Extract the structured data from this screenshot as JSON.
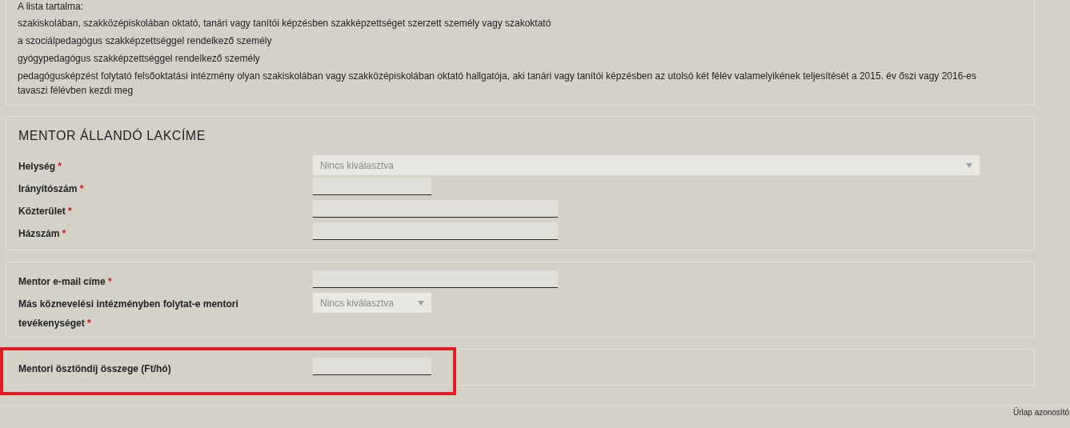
{
  "list_panel": {
    "heading": "A lista tartalma:",
    "items": [
      "szakiskolában, szakközépiskolában oktató, tanári vagy tanítói képzésben szakképzettséget szerzett személy vagy szakoktató",
      "a szociálpedagógus szakképzettséggel rendelkező személy",
      "gyógypedagógus szakképzettséggel rendelkező személy",
      "pedagógusképzést folytató felsőoktatási intézmény olyan szakiskolában vagy szakközépiskolában oktató hallgatója, aki tanári vagy tanítói képzésben az utolsó két félév valamelyikének teljesítését a 2015. év őszi vagy 2016-es tavaszi félévben kezdi meg"
    ]
  },
  "sections": [
    {
      "title": "MENTOR ÁLLANDÓ LAKCÍME",
      "highlight": false,
      "fields": [
        {
          "label": "Helység",
          "marker": "*",
          "kind": "select",
          "placeholder": "Nincs kiválasztva"
        },
        {
          "label": "Irányítószám",
          "marker": "*",
          "kind": "shorttext"
        },
        {
          "label": "Közterület",
          "marker": "*",
          "kind": "longtext"
        },
        {
          "label": "Házszám",
          "marker": "*",
          "kind": "longtext"
        }
      ]
    },
    {
      "highlight": false,
      "fields": [
        {
          "label": "Mentor e-mail címe",
          "marker": "*",
          "kind": "longtext"
        },
        {
          "label": "Más köznevelési intézményben folytat-e mentori tevékenységet",
          "marker": "*",
          "kind": "compactselect",
          "placeholder": "Nincs kiválasztva"
        }
      ]
    },
    {
      "highlight": true,
      "fields": [
        {
          "label": "Mentori ösztöndíj összege (Ft/hó)",
          "kind": "shorttext"
        }
      ]
    }
  ],
  "footer": {
    "form_id_label": "Űrlap azonosító"
  }
}
